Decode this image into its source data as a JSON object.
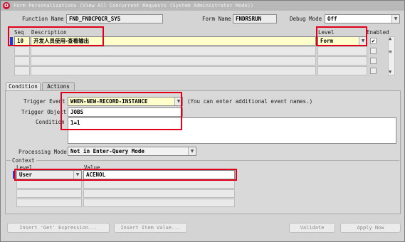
{
  "window": {
    "title": "Form Personalizations (View All Concurrent Requests (System Administrator Mode))"
  },
  "header": {
    "function_name_label": "Function Name",
    "function_name_value": "FND_FNDCPQCR_SYS",
    "form_name_label": "Form Name",
    "form_name_value": "FNDRSRUN",
    "debug_mode_label": "Debug Mode",
    "debug_mode_value": "Off"
  },
  "grid": {
    "seq_header": "Seq",
    "description_header": "Description",
    "level_header": "Level",
    "enabled_header": "Enabled",
    "rows": [
      {
        "seq": "10",
        "description": "开发人员使用-查看输出",
        "level": "Form",
        "enabled": "✔"
      }
    ]
  },
  "tabs": [
    {
      "label": "Condition"
    },
    {
      "label": "Actions"
    }
  ],
  "condition": {
    "trigger_event_label": "Trigger Event",
    "trigger_event_value": "WHEN-NEW-RECORD-INSTANCE",
    "trigger_event_hint": "(You can enter additional event names.)",
    "trigger_object_label": "Trigger Object",
    "trigger_object_value": "JOBS",
    "condition_label": "Condition",
    "condition_value": "1=1",
    "processing_mode_label": "Processing Mode",
    "processing_mode_value": "Not in Enter-Query Mode"
  },
  "context": {
    "title": "Context",
    "level_header": "Level",
    "value_header": "Value",
    "rows": [
      {
        "level": "User",
        "value": "ACENOL"
      }
    ]
  },
  "buttons": {
    "insert_get_expression": "Insert 'Get' Expression...",
    "insert_item_value": "Insert Item Value...",
    "validate": "Validate",
    "apply_now": "Apply Now"
  },
  "glyphs": {
    "dropdown": "▼",
    "scroll_up": "▲",
    "scroll_down": "▼",
    "grip": "≡"
  }
}
